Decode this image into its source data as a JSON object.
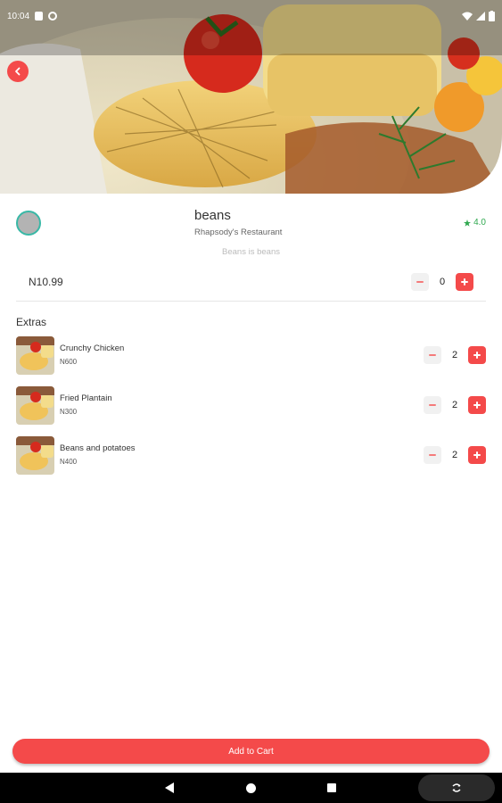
{
  "status_bar": {
    "time": "10:04"
  },
  "item": {
    "title": "beans",
    "restaurant": "Rhapsody's Restaurant",
    "rating": "4.0",
    "description": "Beans is beans",
    "price": "N10.99",
    "quantity": "0"
  },
  "extras": {
    "label": "Extras",
    "items": [
      {
        "name": "Crunchy Chicken",
        "price": "N600",
        "quantity": "2"
      },
      {
        "name": "Fried Plantain",
        "price": "N300",
        "quantity": "2"
      },
      {
        "name": "Beans and potatoes",
        "price": "N400",
        "quantity": "2"
      }
    ]
  },
  "cart_button": {
    "label": "Add to Cart"
  },
  "colors": {
    "accent": "#f44a4a",
    "rating": "#2fa84f",
    "avatar_ring": "#39b8a6"
  },
  "icons": {
    "back": "chevron-left-icon",
    "star": "star-icon",
    "nav_back": "triangle-back-icon",
    "nav_home": "circle-home-icon",
    "nav_recent": "square-recent-icon",
    "rotate": "rotate-icon"
  }
}
